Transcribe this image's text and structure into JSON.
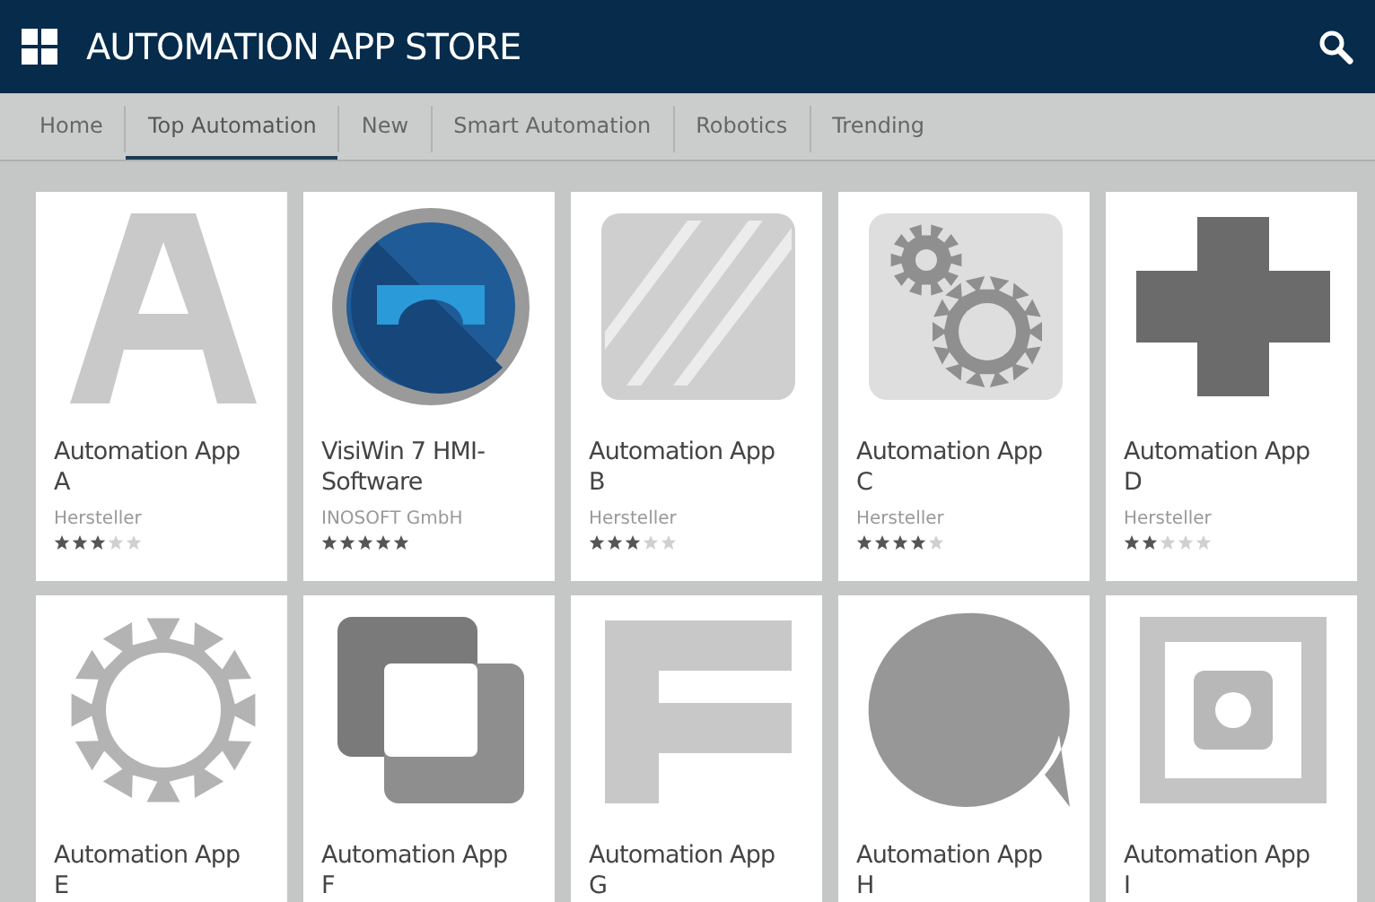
{
  "header": {
    "title": "AUTOMATION APP STORE"
  },
  "tabs": [
    {
      "label": "Home",
      "selected": false
    },
    {
      "label": "Top Automation",
      "selected": true
    },
    {
      "label": "New",
      "selected": false
    },
    {
      "label": "Smart Automation",
      "selected": false
    },
    {
      "label": "Robotics",
      "selected": false
    },
    {
      "label": "Trending",
      "selected": false
    }
  ],
  "apps": [
    {
      "name": "Automation App A",
      "kind": "arch",
      "publisher": "Hersteller",
      "stars": 3
    },
    {
      "name": "VisiWin 7 HMI-Software",
      "kind": "disc",
      "publisher": "INOSOFT GmbH",
      "stars": 5
    },
    {
      "name": "Automation App B",
      "kind": "stripes",
      "publisher": "Hersteller",
      "stars": 3
    },
    {
      "name": "Automation App C",
      "kind": "gears",
      "publisher": "Hersteller",
      "stars": 4
    },
    {
      "name": "Automation App D",
      "kind": "cross",
      "publisher": "Hersteller",
      "stars": 2
    },
    {
      "name": "Automation App E",
      "kind": "gear"
    },
    {
      "name": "Automation App F",
      "kind": "squares"
    },
    {
      "name": "Automation App G",
      "kind": "bars"
    },
    {
      "name": "Automation App H",
      "kind": "bubble"
    },
    {
      "name": "Automation App I",
      "kind": "ring"
    }
  ]
}
